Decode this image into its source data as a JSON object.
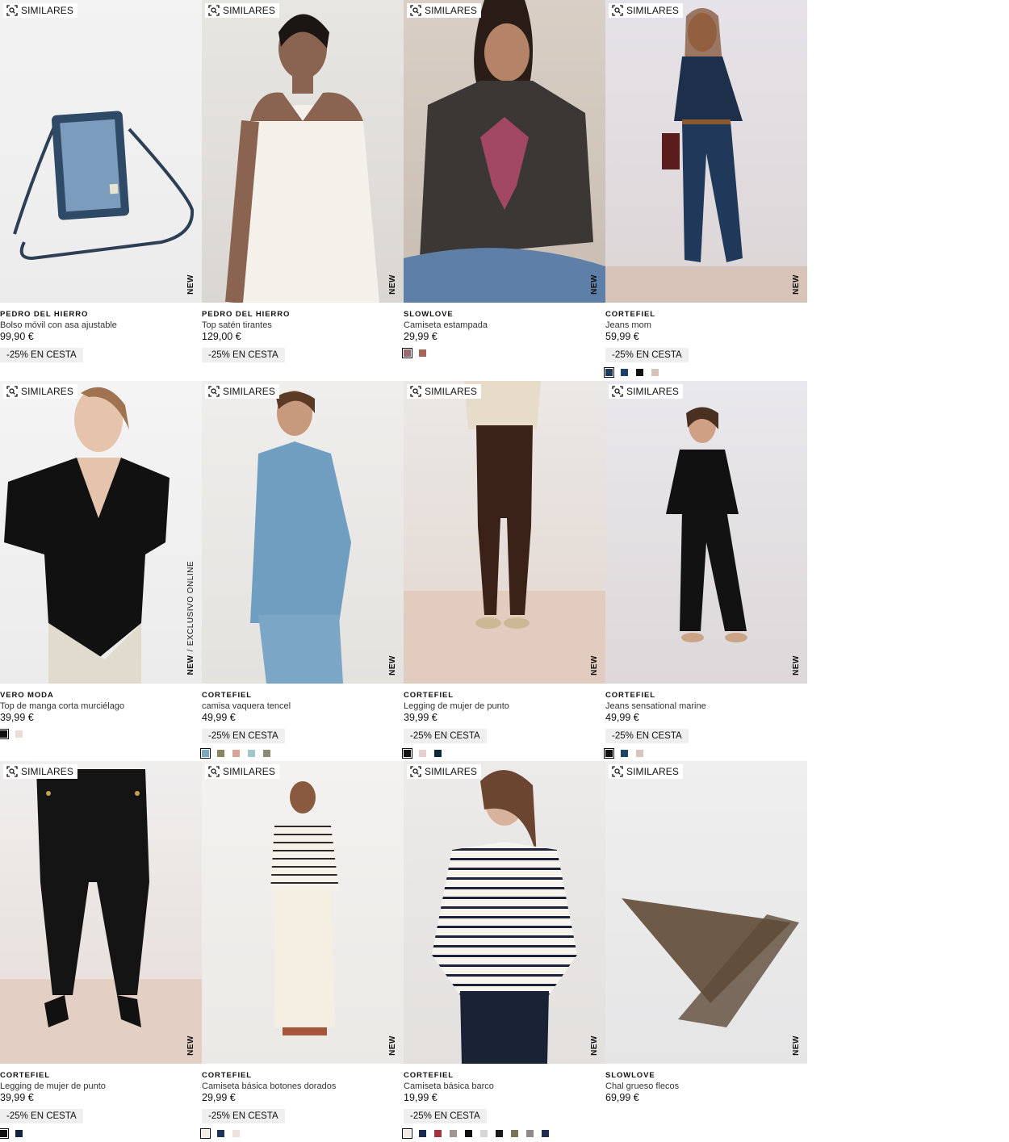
{
  "similar_label": "SIMILARES",
  "products": [
    {
      "brand": "PEDRO DEL HIERRO",
      "name": "Bolso móvil con asa ajustable",
      "price": "99,90 €",
      "promo": "-25% EN CESTA",
      "tag": "NEW",
      "exclusive": "",
      "bg": "linear-gradient(180deg,#f3f3f3,#ececec)",
      "art": "bag",
      "swatches": []
    },
    {
      "brand": "PEDRO DEL HIERRO",
      "name": "Top satén tirantes",
      "price": "129,00 €",
      "promo": "-25% EN CESTA",
      "tag": "NEW",
      "exclusive": "",
      "bg": "linear-gradient(180deg,#e8e6e3,#dad7d3)",
      "art": "satin",
      "swatches": []
    },
    {
      "brand": "SLOWLOVE",
      "name": "Camiseta estampada",
      "price": "29,99 €",
      "promo": "",
      "tag": "NEW",
      "exclusive": "",
      "bg": "linear-gradient(180deg,#d9cfc6,#c9bdb2)",
      "art": "tee",
      "swatches": [
        "#9a6a72",
        "#a8665a"
      ]
    },
    {
      "brand": "CORTEFIEL",
      "name": "Jeans mom",
      "price": "59,99 €",
      "promo": "-25% EN CESTA",
      "tag": "NEW",
      "exclusive": "",
      "bg": "linear-gradient(180deg,#e6e3e8,#dcd5d6)",
      "art": "jeans",
      "swatches": [
        "#1f3a5a",
        "#1b3f66",
        "#111111",
        "#d7c2b9"
      ]
    },
    {
      "brand": "VERO MODA",
      "name": "Top de manga corta murciélago",
      "price": "39,99 €",
      "promo": "",
      "tag": "NEW",
      "exclusive": "EXCLUSIVO ONLINE",
      "bg": "linear-gradient(180deg,#f4f4f4,#ececec)",
      "art": "blouse",
      "swatches": [
        "#111111",
        "#eadcd7"
      ]
    },
    {
      "brand": "CORTEFIEL",
      "name": "camisa vaquera tencel",
      "price": "49,99 €",
      "promo": "-25% EN CESTA",
      "tag": "NEW",
      "exclusive": "",
      "bg": "linear-gradient(180deg,#efeeec,#e4e2df)",
      "art": "denim",
      "swatches": [
        "#7aa7c2",
        "#8a8460",
        "#d9a597",
        "#9fc6c9",
        "#8d8a73"
      ]
    },
    {
      "brand": "CORTEFIEL",
      "name": "Legging de mujer de punto",
      "price": "39,99 €",
      "promo": "-25% EN CESTA",
      "tag": "NEW",
      "exclusive": "",
      "bg": "linear-gradient(180deg,#ebe8e6,#e2d6cf)",
      "art": "legging",
      "swatches": [
        "#111111",
        "#e8cfd0",
        "#0e2a3a"
      ]
    },
    {
      "brand": "CORTEFIEL",
      "name": "Jeans sensational marine",
      "price": "49,99 €",
      "promo": "-25% EN CESTA",
      "tag": "NEW",
      "exclusive": "",
      "bg": "linear-gradient(180deg,#e9e8ec,#ddd8d9)",
      "art": "black",
      "swatches": [
        "#111111",
        "#1e4468",
        "#d8c4c0"
      ]
    },
    {
      "brand": "CORTEFIEL",
      "name": "Legging de mujer de punto",
      "price": "39,99 €",
      "promo": "-25% EN CESTA",
      "tag": "NEW",
      "exclusive": "",
      "bg": "linear-gradient(180deg,#efeeee,#e6dcd6)",
      "art": "legging2",
      "swatches": [
        "#111111",
        "#13263d"
      ]
    },
    {
      "brand": "CORTEFIEL",
      "name": "Camiseta básica botones dorados",
      "price": "29,99 €",
      "promo": "-25% EN CESTA",
      "tag": "NEW",
      "exclusive": "",
      "bg": "linear-gradient(180deg,#f3f2f0,#ebe9e6)",
      "art": "stripes",
      "swatches": [
        "#f4efe2",
        "#1f3358",
        "#efe1dc"
      ]
    },
    {
      "brand": "CORTEFIEL",
      "name": "Camiseta básica barco",
      "price": "19,99 €",
      "promo": "-25% EN CESTA",
      "tag": "NEW",
      "exclusive": "",
      "bg": "linear-gradient(180deg,#ecebea,#e3e0de)",
      "art": "stripes2",
      "swatches": [
        "#f1ede4",
        "#1b2b4e",
        "#a7323f",
        "#9d978f",
        "#111111",
        "#d7d7d9",
        "#1a1a1a",
        "#7c735a",
        "#8c8c8c",
        "#1d2c4f"
      ]
    },
    {
      "brand": "SLOWLOVE",
      "name": "Chal grueso flecos",
      "price": "69,99 €",
      "promo": "",
      "tag": "NEW",
      "exclusive": "",
      "bg": "linear-gradient(180deg,#efefef,#e5e5e6)",
      "art": "scarf",
      "swatches": []
    }
  ]
}
